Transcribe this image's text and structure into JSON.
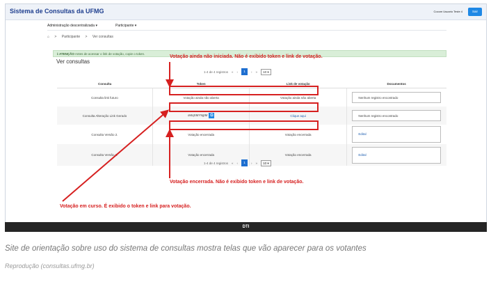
{
  "app": {
    "title": "Sistema de Consultas da UFMG",
    "user": "Cocom Usuario Teste 4",
    "logout_label": "Sair"
  },
  "nav": {
    "items": [
      "Administração descentralizada ▾",
      "Participante ▾"
    ]
  },
  "breadcrumb": {
    "home_icon": "home-icon",
    "items": [
      "Participante",
      "Ver consultas"
    ]
  },
  "alert": {
    "label": "ATENÇÃO",
    "text": "Antes de acessar o link de votação, copie o token."
  },
  "page": {
    "title": "Ver consultas"
  },
  "pager": {
    "info": "1-4 de 4 registros",
    "first": "«",
    "prev": "‹",
    "current": "1",
    "next": "›",
    "last": "»",
    "page_size": "10 ▾"
  },
  "table": {
    "headers": [
      "Consulta",
      "Token",
      "Link de votação",
      "Documentos"
    ],
    "rows": [
      {
        "consulta": "Consulta link futuro",
        "token": "Votação ainda não aberta",
        "link": "Votação ainda não aberta",
        "documentos": "Nenhum registro encontrado"
      },
      {
        "consulta": "Consulta Alteração Link Gerado",
        "token": "oMqSMY9gtM",
        "link": "Clique aqui",
        "documentos": "Nenhum registro encontrado"
      },
      {
        "consulta": "Consulta Versão 2.",
        "token": "Votação encerrada",
        "link": "Votação encerrada",
        "documentos": "Edital"
      },
      {
        "consulta": "Consulta Versão 2.",
        "token": "Votação encerrada",
        "link": "Votação encerrada",
        "documentos": "Edital"
      }
    ]
  },
  "annotations": {
    "top": "Votação ainda não iniciada. Não é exibido token e link de votação.",
    "middle": "Votação encerrada. Não é exibido token e link de votação.",
    "bottom": "Votação em curso. É exibido o token e link para votação."
  },
  "footer": {
    "label": "DTI"
  },
  "caption": "Site de orientação sobre uso do sistema de consultas mostra telas que vão aparecer para os votantes",
  "credit": "Reprodução (consultas.ufmg.br)",
  "colors": {
    "brand": "#1f3f8f",
    "accent": "#1e88e5",
    "annotation_red": "#d62020",
    "alert_bg": "#d9eed8",
    "footer_bg": "#252525"
  }
}
